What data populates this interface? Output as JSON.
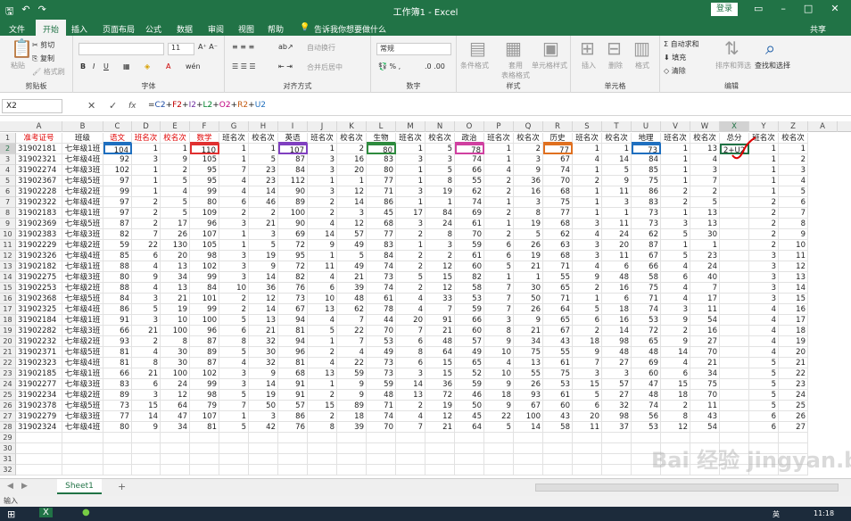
{
  "window": {
    "title": "工作簿1 - Excel",
    "login": "登录"
  },
  "tabs": [
    "文件",
    "开始",
    "插入",
    "页面布局",
    "公式",
    "数据",
    "审阅",
    "视图",
    "帮助",
    "告诉我你想要做什么"
  ],
  "share": "共享",
  "ribbon": {
    "clipboard": {
      "label": "剪贴板",
      "paste": "粘贴",
      "cut": "剪切",
      "copy": "复制",
      "painter": "格式刷"
    },
    "font": {
      "label": "字体",
      "font_name": "",
      "font_size": "11"
    },
    "alignment": {
      "label": "对齐方式",
      "wrap": "自动换行",
      "merge": "合并后居中"
    },
    "number": {
      "label": "数字",
      "format": "常规"
    },
    "styles": {
      "label": "样式",
      "cond": "条件格式",
      "table": "套用\n表格格式",
      "cell": "单元格样式"
    },
    "cells": {
      "label": "单元格",
      "insert": "插入",
      "delete": "删除",
      "format": "格式"
    },
    "editing": {
      "label": "编辑",
      "autosum": "自动求和",
      "fill": "填充",
      "clear": "清除",
      "sort": "排序和筛选",
      "find": "查找和选择"
    }
  },
  "formula_bar": {
    "cell": "X2",
    "fx": "fx",
    "parts": [
      [
        "=",
        "f-x"
      ],
      [
        "C2",
        "f-c"
      ],
      [
        "+",
        "f-x"
      ],
      [
        "F2",
        "f-f"
      ],
      [
        "+",
        "f-x"
      ],
      [
        "I2",
        "f-i"
      ],
      [
        "+",
        "f-x"
      ],
      [
        "L2",
        "f-l"
      ],
      [
        "+",
        "f-x"
      ],
      [
        "O2",
        "f-o"
      ],
      [
        "+",
        "f-x"
      ],
      [
        "R2",
        "f-r"
      ],
      [
        "+",
        "f-x"
      ],
      [
        "U2",
        "f-u"
      ]
    ]
  },
  "columns": [
    "A",
    "B",
    "C",
    "D",
    "E",
    "F",
    "G",
    "H",
    "I",
    "J",
    "K",
    "L",
    "M",
    "N",
    "O",
    "P",
    "Q",
    "R",
    "S",
    "T",
    "U",
    "V",
    "W",
    "X",
    "Y",
    "Z",
    "A"
  ],
  "header_row": [
    "准考证号",
    "班级",
    "语文",
    "班名次",
    "校名次",
    "数学",
    "班名次",
    "校名次",
    "英语",
    "班名次",
    "校名次",
    "生物",
    "班名次",
    "校名次",
    "政治",
    "班名次",
    "校名次",
    "历史",
    "班名次",
    "校名次",
    "地理",
    "班名次",
    "校名次",
    "总分",
    "班名次",
    "校名次"
  ],
  "rows": [
    [
      "31902181",
      "七年级1班",
      "104",
      "1",
      "1",
      "110",
      "1",
      "1",
      "107",
      "1",
      "2",
      "80",
      "1",
      "5",
      "78",
      "1",
      "2",
      "77",
      "1",
      "1",
      "73",
      "1",
      "13",
      "2+U2",
      "1",
      "1"
    ],
    [
      "31902321",
      "七年级4班",
      "92",
      "3",
      "9",
      "105",
      "1",
      "5",
      "87",
      "3",
      "16",
      "83",
      "3",
      "3",
      "74",
      "1",
      "3",
      "67",
      "4",
      "14",
      "84",
      "1",
      "4",
      "",
      "1",
      "2"
    ],
    [
      "31902274",
      "七年级3班",
      "102",
      "1",
      "2",
      "95",
      "7",
      "23",
      "84",
      "3",
      "20",
      "80",
      "1",
      "5",
      "66",
      "4",
      "9",
      "74",
      "1",
      "5",
      "85",
      "1",
      "3",
      "",
      "1",
      "3"
    ],
    [
      "31902367",
      "七年级5班",
      "97",
      "1",
      "5",
      "95",
      "4",
      "23",
      "112",
      "1",
      "1",
      "77",
      "1",
      "8",
      "55",
      "2",
      "36",
      "70",
      "2",
      "9",
      "75",
      "1",
      "7",
      "",
      "1",
      "4"
    ],
    [
      "31902228",
      "七年级2班",
      "99",
      "1",
      "4",
      "99",
      "4",
      "14",
      "90",
      "3",
      "12",
      "71",
      "3",
      "19",
      "62",
      "2",
      "16",
      "68",
      "1",
      "11",
      "86",
      "2",
      "2",
      "",
      "1",
      "5"
    ],
    [
      "31902322",
      "七年级4班",
      "97",
      "2",
      "5",
      "80",
      "6",
      "46",
      "89",
      "2",
      "14",
      "86",
      "1",
      "1",
      "74",
      "1",
      "3",
      "75",
      "1",
      "3",
      "83",
      "2",
      "5",
      "",
      "2",
      "6"
    ],
    [
      "31902183",
      "七年级1班",
      "97",
      "2",
      "5",
      "109",
      "2",
      "2",
      "100",
      "2",
      "3",
      "45",
      "17",
      "84",
      "69",
      "2",
      "8",
      "77",
      "1",
      "1",
      "73",
      "1",
      "13",
      "",
      "2",
      "7"
    ],
    [
      "31902369",
      "七年级5班",
      "87",
      "2",
      "17",
      "96",
      "3",
      "21",
      "90",
      "4",
      "12",
      "68",
      "3",
      "24",
      "61",
      "1",
      "19",
      "68",
      "3",
      "11",
      "73",
      "3",
      "13",
      "",
      "2",
      "8"
    ],
    [
      "31902383",
      "七年级3班",
      "82",
      "7",
      "26",
      "107",
      "1",
      "3",
      "69",
      "14",
      "57",
      "77",
      "2",
      "8",
      "70",
      "2",
      "5",
      "62",
      "4",
      "24",
      "62",
      "5",
      "30",
      "",
      "2",
      "9"
    ],
    [
      "31902229",
      "七年级2班",
      "59",
      "22",
      "130",
      "105",
      "1",
      "5",
      "72",
      "9",
      "49",
      "83",
      "1",
      "3",
      "59",
      "6",
      "26",
      "63",
      "3",
      "20",
      "87",
      "1",
      "1",
      "",
      "2",
      "10"
    ],
    [
      "31902326",
      "七年级4班",
      "85",
      "6",
      "20",
      "98",
      "3",
      "19",
      "95",
      "1",
      "5",
      "84",
      "2",
      "2",
      "61",
      "6",
      "19",
      "68",
      "3",
      "11",
      "67",
      "5",
      "23",
      "",
      "3",
      "11"
    ],
    [
      "31902182",
      "七年级1班",
      "88",
      "4",
      "13",
      "102",
      "3",
      "9",
      "72",
      "11",
      "49",
      "74",
      "2",
      "12",
      "60",
      "5",
      "21",
      "71",
      "4",
      "6",
      "66",
      "4",
      "24",
      "",
      "3",
      "12"
    ],
    [
      "31902275",
      "七年级3班",
      "80",
      "9",
      "34",
      "99",
      "3",
      "14",
      "82",
      "4",
      "21",
      "73",
      "5",
      "15",
      "82",
      "1",
      "1",
      "55",
      "9",
      "48",
      "58",
      "6",
      "40",
      "",
      "3",
      "13"
    ],
    [
      "31902253",
      "七年级2班",
      "88",
      "4",
      "13",
      "84",
      "10",
      "36",
      "76",
      "6",
      "39",
      "74",
      "2",
      "12",
      "58",
      "7",
      "30",
      "65",
      "2",
      "16",
      "75",
      "4",
      "7",
      "",
      "3",
      "14"
    ],
    [
      "31902368",
      "七年级5班",
      "84",
      "3",
      "21",
      "101",
      "2",
      "12",
      "73",
      "10",
      "48",
      "61",
      "4",
      "33",
      "53",
      "7",
      "50",
      "71",
      "1",
      "6",
      "71",
      "4",
      "17",
      "",
      "3",
      "15"
    ],
    [
      "31902325",
      "七年级4班",
      "86",
      "5",
      "19",
      "99",
      "2",
      "14",
      "67",
      "13",
      "62",
      "78",
      "4",
      "7",
      "59",
      "7",
      "26",
      "64",
      "5",
      "18",
      "74",
      "3",
      "11",
      "",
      "4",
      "16"
    ],
    [
      "31902184",
      "七年级1班",
      "91",
      "3",
      "10",
      "100",
      "5",
      "13",
      "94",
      "4",
      "7",
      "44",
      "20",
      "91",
      "66",
      "3",
      "9",
      "65",
      "6",
      "16",
      "53",
      "9",
      "54",
      "",
      "4",
      "17"
    ],
    [
      "31902282",
      "七年级3班",
      "66",
      "21",
      "100",
      "96",
      "6",
      "21",
      "81",
      "5",
      "22",
      "70",
      "7",
      "21",
      "60",
      "8",
      "21",
      "67",
      "2",
      "14",
      "72",
      "2",
      "16",
      "",
      "4",
      "18"
    ],
    [
      "31902232",
      "七年级2班",
      "93",
      "2",
      "8",
      "87",
      "8",
      "32",
      "94",
      "1",
      "7",
      "53",
      "6",
      "48",
      "57",
      "9",
      "34",
      "43",
      "18",
      "98",
      "65",
      "9",
      "27",
      "",
      "4",
      "19"
    ],
    [
      "31902371",
      "七年级5班",
      "81",
      "4",
      "30",
      "89",
      "5",
      "30",
      "96",
      "2",
      "4",
      "49",
      "8",
      "64",
      "49",
      "10",
      "75",
      "55",
      "9",
      "48",
      "48",
      "14",
      "70",
      "",
      "4",
      "20"
    ],
    [
      "31902323",
      "七年级4班",
      "81",
      "8",
      "30",
      "87",
      "4",
      "32",
      "81",
      "4",
      "22",
      "73",
      "6",
      "15",
      "65",
      "4",
      "13",
      "61",
      "7",
      "27",
      "69",
      "4",
      "21",
      "",
      "5",
      "21"
    ],
    [
      "31902185",
      "七年级1班",
      "66",
      "21",
      "100",
      "102",
      "3",
      "9",
      "68",
      "13",
      "59",
      "73",
      "3",
      "15",
      "52",
      "10",
      "55",
      "75",
      "3",
      "3",
      "60",
      "6",
      "34",
      "",
      "5",
      "22"
    ],
    [
      "31902277",
      "七年级3班",
      "83",
      "6",
      "24",
      "99",
      "3",
      "14",
      "91",
      "1",
      "9",
      "59",
      "14",
      "36",
      "59",
      "9",
      "26",
      "53",
      "15",
      "57",
      "47",
      "15",
      "75",
      "",
      "5",
      "23"
    ],
    [
      "31902234",
      "七年级2班",
      "89",
      "3",
      "12",
      "98",
      "5",
      "19",
      "91",
      "2",
      "9",
      "48",
      "13",
      "72",
      "46",
      "18",
      "93",
      "61",
      "5",
      "27",
      "48",
      "18",
      "70",
      "",
      "5",
      "24"
    ],
    [
      "31902378",
      "七年级5班",
      "73",
      "15",
      "64",
      "79",
      "7",
      "50",
      "57",
      "15",
      "89",
      "71",
      "2",
      "19",
      "50",
      "9",
      "67",
      "60",
      "6",
      "32",
      "74",
      "2",
      "11",
      "",
      "5",
      "25"
    ],
    [
      "31902279",
      "七年级3班",
      "77",
      "14",
      "47",
      "107",
      "1",
      "3",
      "86",
      "2",
      "18",
      "74",
      "4",
      "12",
      "45",
      "22",
      "100",
      "43",
      "20",
      "98",
      "56",
      "8",
      "43",
      "",
      "6",
      "26"
    ],
    [
      "31902324",
      "七年级4班",
      "80",
      "9",
      "34",
      "81",
      "5",
      "42",
      "76",
      "8",
      "39",
      "70",
      "7",
      "21",
      "64",
      "5",
      "14",
      "58",
      "11",
      "37",
      "53",
      "12",
      "54",
      "",
      "6",
      "27"
    ]
  ],
  "empty_rows": [
    "29",
    "30",
    "31",
    "32"
  ],
  "sheet": {
    "name": "Sheet1",
    "add": "+"
  },
  "status": "输入",
  "taskbar": {
    "time": "11:18",
    "lang": "英"
  },
  "watermark": "Bai 经验 jingyan.baidu.com"
}
